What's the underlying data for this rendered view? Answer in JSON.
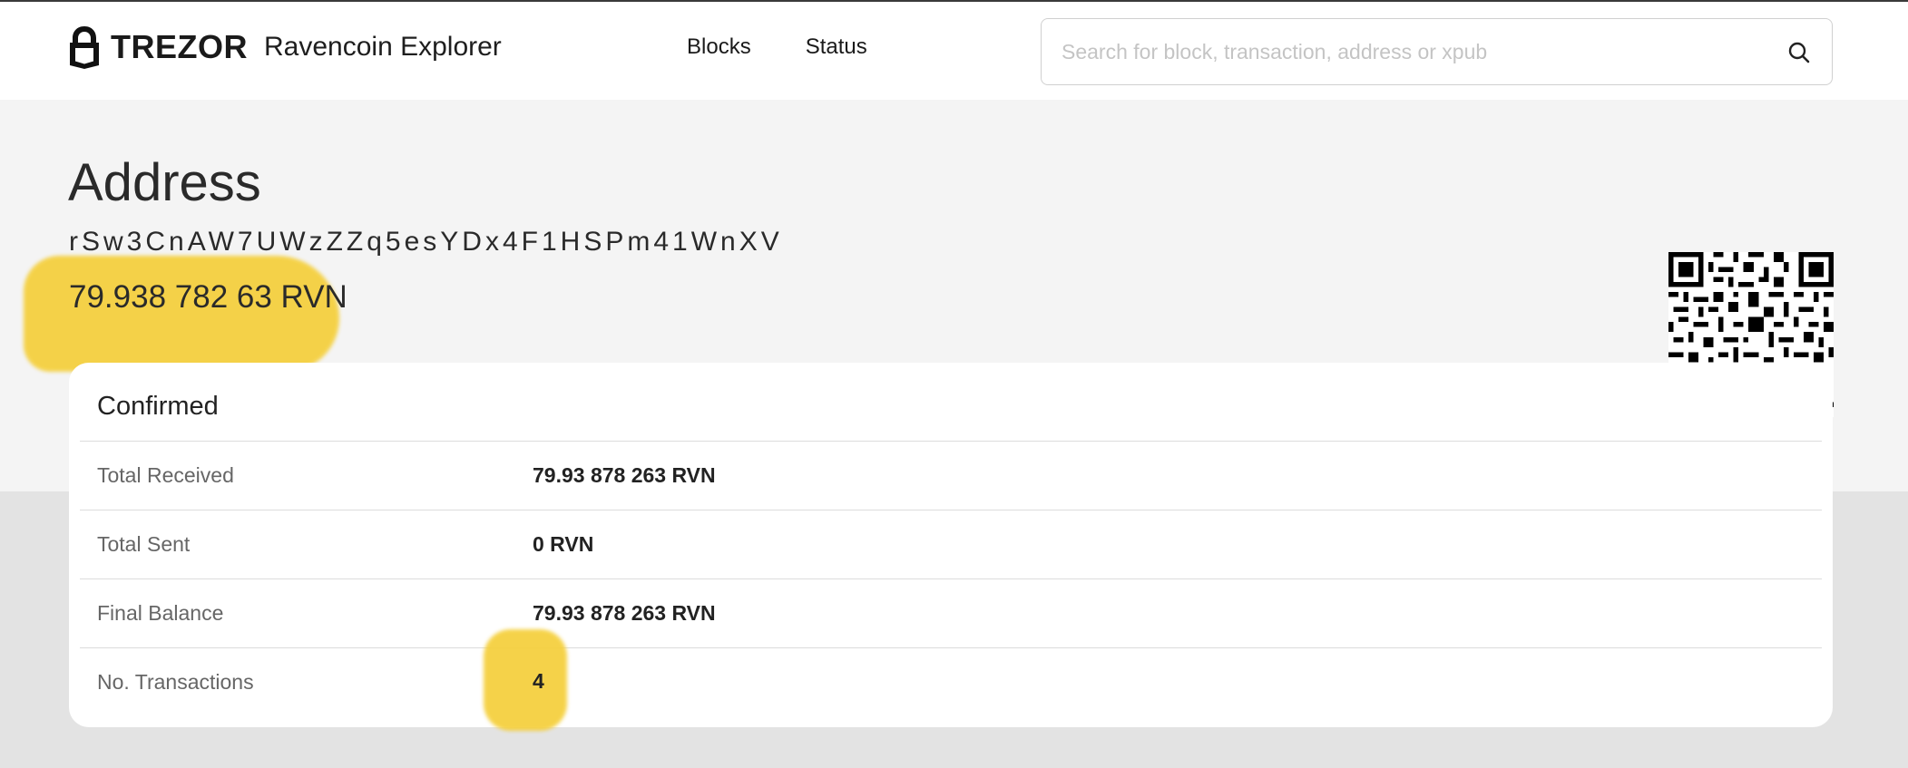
{
  "header": {
    "brand": "TREZOR",
    "app_name": "Ravencoin Explorer",
    "nav": [
      {
        "label": "Blocks"
      },
      {
        "label": "Status"
      }
    ],
    "search": {
      "placeholder": "Search for block, transaction, address or xpub",
      "icon": "search-icon"
    }
  },
  "page": {
    "title": "Address",
    "address": "rSw3CnAW7UWzZZq5esYDx4F1HSPm41WnXV",
    "balance": "79.938 782 63 RVN"
  },
  "summary": {
    "section_title": "Confirmed",
    "rows": [
      {
        "label": "Total Received",
        "value": "79.93 878 263 RVN"
      },
      {
        "label": "Total Sent",
        "value": "0 RVN"
      },
      {
        "label": "Final Balance",
        "value": "79.93 878 263 RVN"
      },
      {
        "label": "No. Transactions",
        "value": "4"
      }
    ]
  },
  "colors": {
    "highlight": "#f5cf3a",
    "header_bg": "#ffffff",
    "hero_bg": "#f4f4f4",
    "page_bg": "#e3e3e3"
  }
}
